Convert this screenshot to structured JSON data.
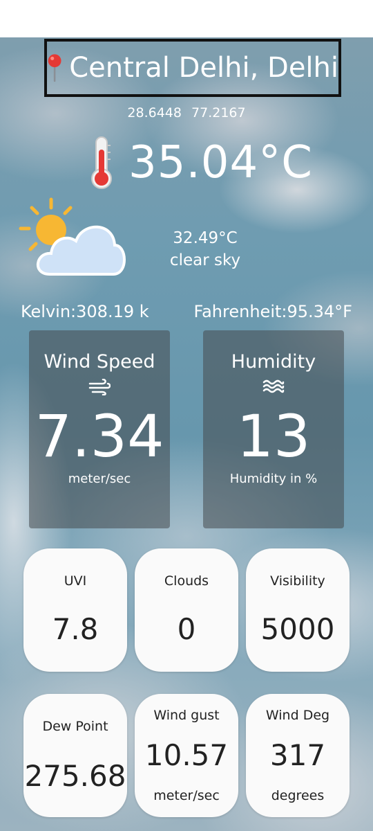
{
  "location": {
    "name": "Central Delhi, Delhi",
    "latitude": "28.6448",
    "longitude": "77.2167"
  },
  "current": {
    "temperature": "35.04°C",
    "feels_like": "32.49°C",
    "description": "clear sky",
    "kelvin": "Kelvin:308.19 k",
    "fahrenheit": "Fahrenheit:95.34°F"
  },
  "wind_card": {
    "title": "Wind Speed",
    "icon": "wind-icon",
    "value": "7.34",
    "unit": "meter/sec"
  },
  "humidity_card": {
    "title": "Humidity",
    "icon": "waves-icon",
    "value": "13",
    "unit": "Humidity in %"
  },
  "tiles": {
    "uvi": {
      "label": "UVI",
      "value": "7.8"
    },
    "clouds": {
      "label": "Clouds",
      "value": "0"
    },
    "visibility": {
      "label": "Visibility",
      "value": "5000"
    },
    "dew_point": {
      "label": "Dew Point",
      "value": "275.68"
    },
    "wind_gust": {
      "label": "Wind gust",
      "value": "10.57",
      "unit": "meter/sec"
    },
    "wind_deg": {
      "label": "Wind Deg",
      "value": "317",
      "unit": "degrees"
    }
  },
  "icons": {
    "location": "map-pin-icon",
    "temperature": "thermometer-icon",
    "weather": "partly-cloudy-icon"
  },
  "colors": {
    "pin": "#e53935",
    "sun": "#f7b733",
    "cloud": "#cfe2f7",
    "text_light": "#ffffff",
    "tile_bg": "#fafafa"
  }
}
